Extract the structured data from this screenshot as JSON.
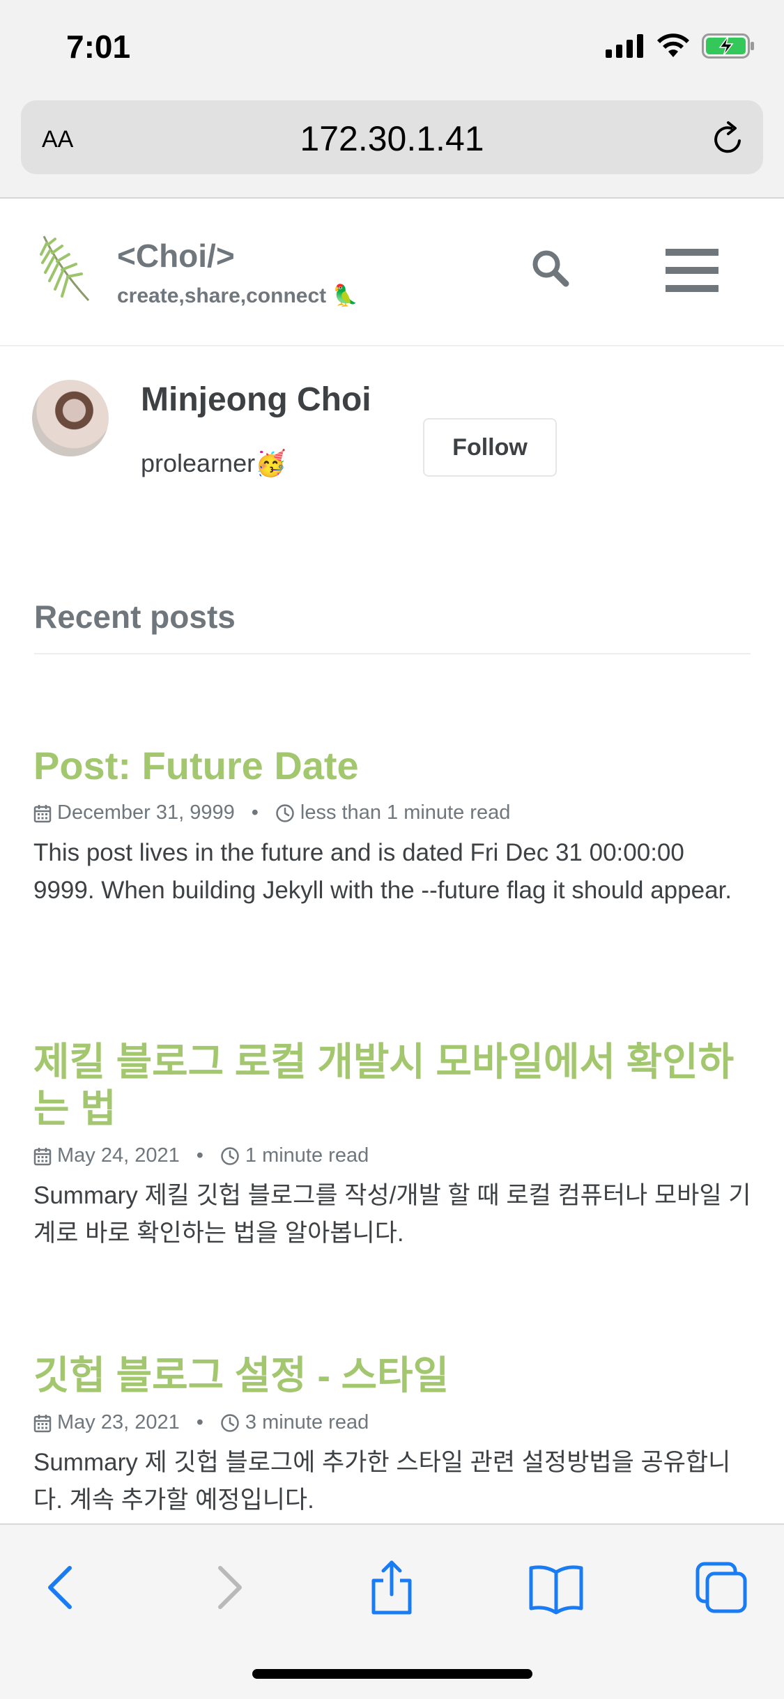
{
  "status_bar": {
    "time": "7:01"
  },
  "browser": {
    "text_size_label": "AA",
    "url": "172.30.1.41"
  },
  "site": {
    "title": "<Choi/>",
    "subtitle": "create,share,connect 🦜"
  },
  "author": {
    "name": "Minjeong Choi",
    "bio": "prolearner🥳",
    "follow_label": "Follow"
  },
  "recent_posts": {
    "heading": "Recent posts",
    "posts": [
      {
        "title": "Post: Future Date",
        "date": "December 31, 9999",
        "read_time": "less than 1 minute read",
        "excerpt": "This post lives in the future and is dated Fri Dec 31 00:00:00 9999. When building Jekyll with the --future flag it should appear."
      },
      {
        "title": "제킬 블로그 로컬 개발시 모바일에서 확인하는 법",
        "date": "May 24, 2021",
        "read_time": "1 minute read",
        "excerpt": "Summary 제킬 깃헙 블로그를 작성/개발 할 때 로컬 컴퓨터나 모바일 기계로 바로 확인하는 법을 알아봅니다."
      },
      {
        "title": "깃헙 블로그 설정 - 스타일",
        "date": "May 23, 2021",
        "read_time": "3 minute read",
        "excerpt": "Summary 제 깃헙 블로그에 추가한 스타일 관련 설정방법을 공유합니다. 계속 추가할 예정입니다."
      }
    ]
  },
  "colors": {
    "post_title": "#a3c76f",
    "muted_text": "#6f777d",
    "body_text": "#3d4144",
    "ios_blue": "#1a7cf4"
  },
  "icons": {
    "logo": "palm-leaf-icon",
    "search": "search-icon",
    "menu": "hamburger-menu-icon",
    "date": "calendar-icon",
    "read_time": "clock-icon"
  }
}
